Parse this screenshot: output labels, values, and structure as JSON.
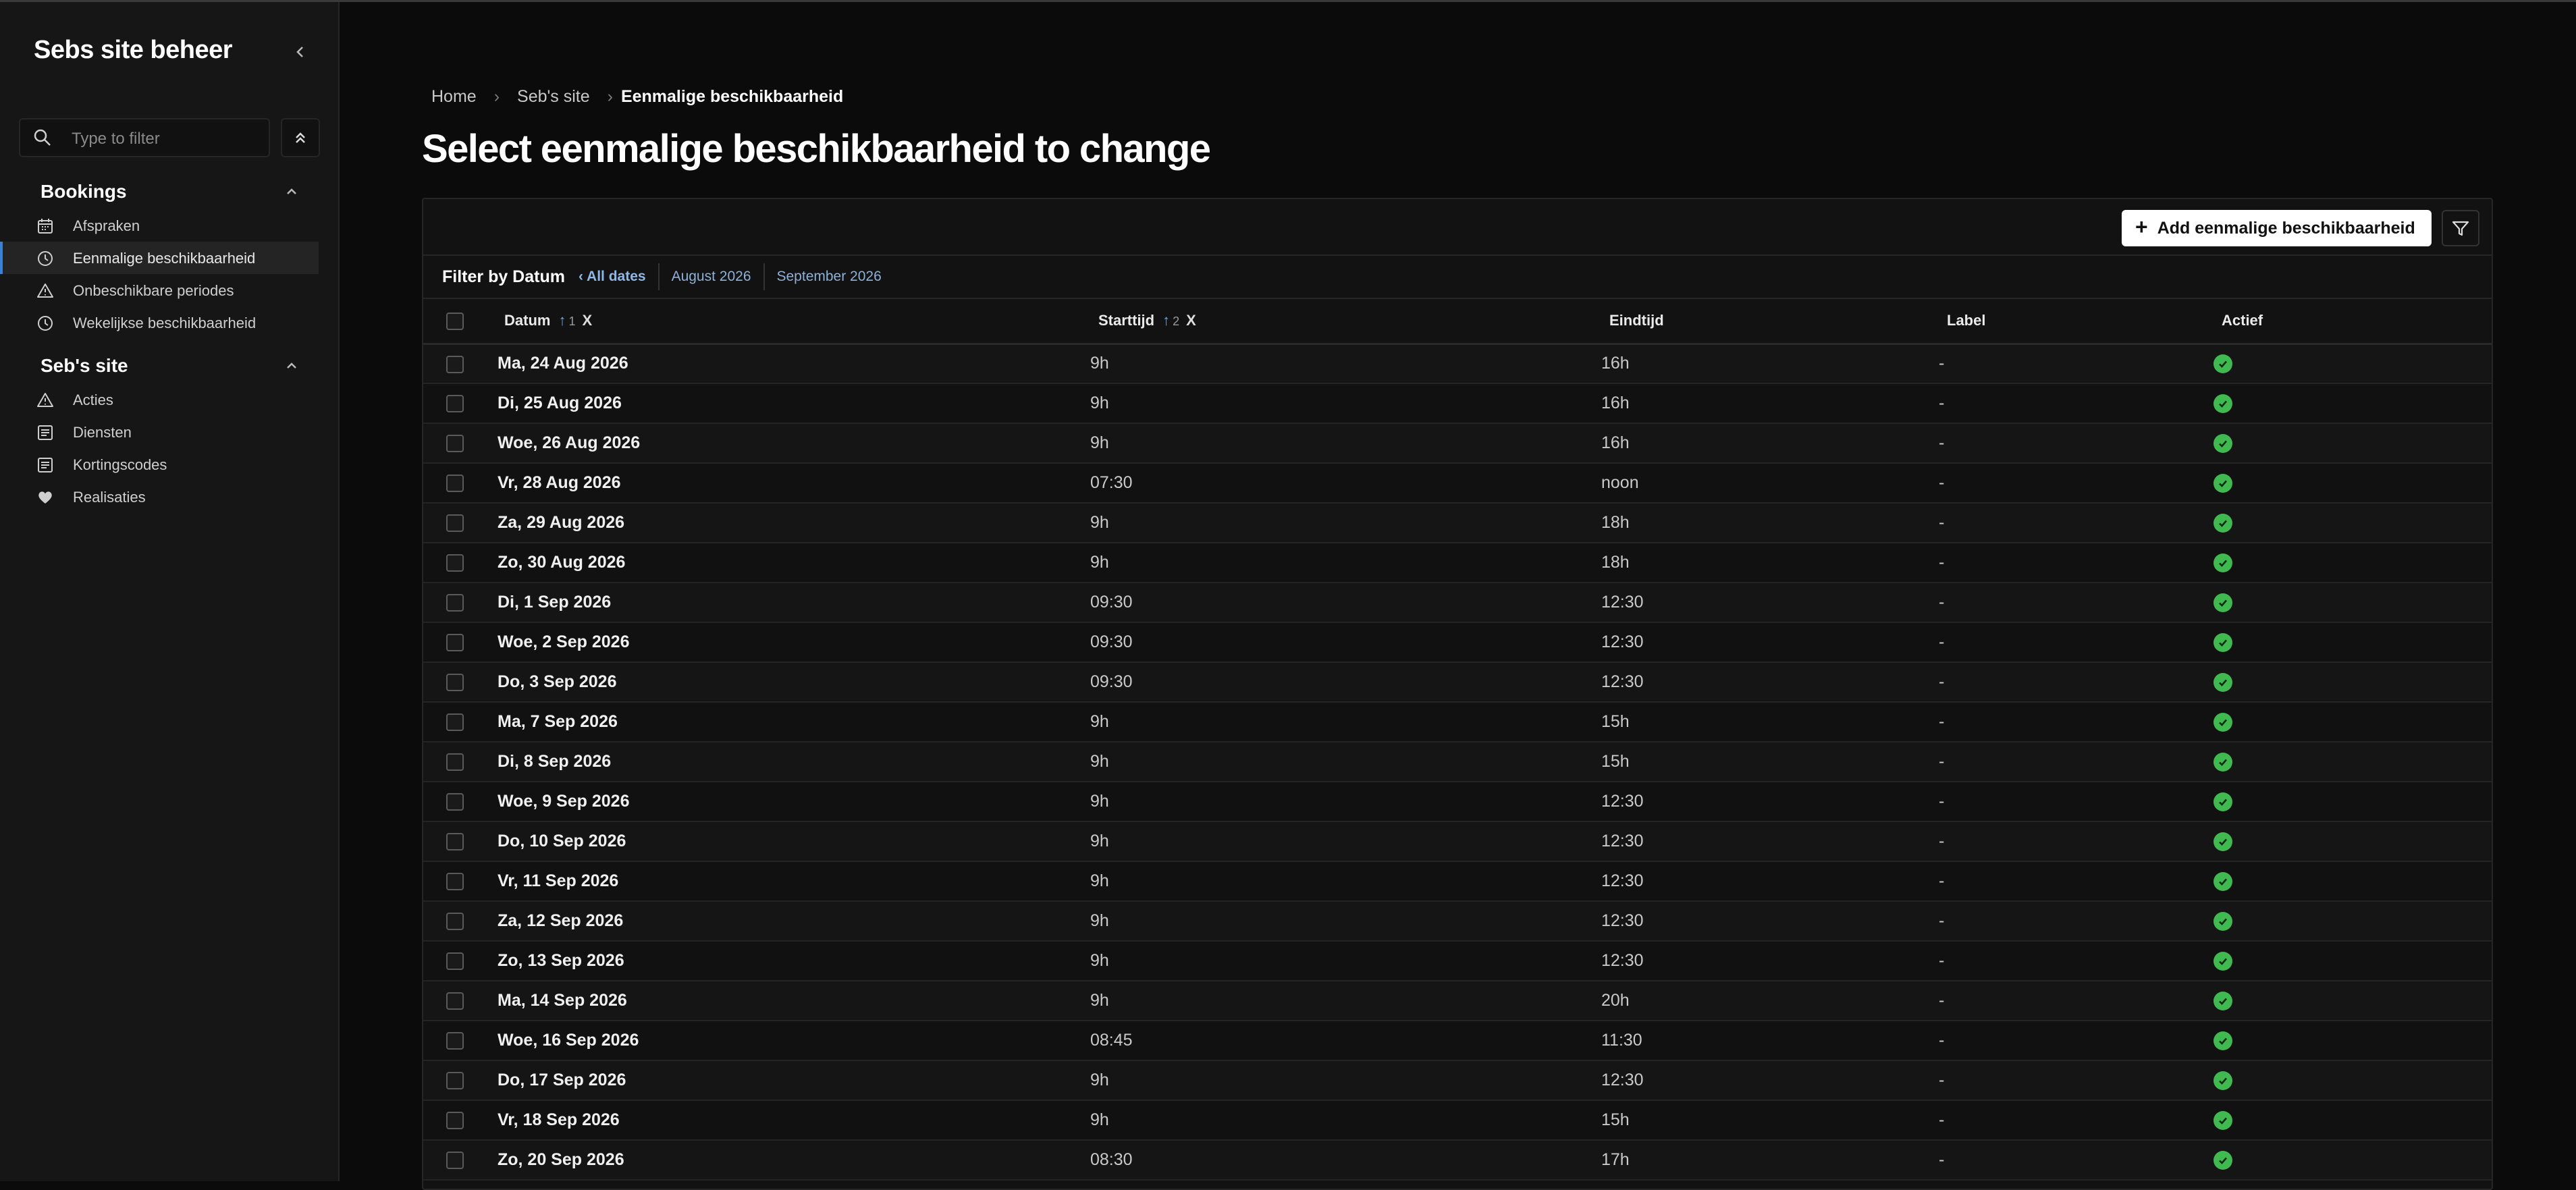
{
  "sidebar": {
    "brand": "Sebs site beheer",
    "search_placeholder": "Type to filter",
    "sections": [
      {
        "title": "Bookings",
        "items": [
          {
            "label": "Afspraken",
            "icon": "calendar-icon"
          },
          {
            "label": "Eenmalige beschikbaarheid",
            "icon": "clock-icon",
            "active": true
          },
          {
            "label": "Onbeschikbare periodes",
            "icon": "warning-icon"
          },
          {
            "label": "Wekelijkse beschikbaarheid",
            "icon": "clock-icon"
          }
        ]
      },
      {
        "title": "Seb's site",
        "items": [
          {
            "label": "Acties",
            "icon": "warning-icon"
          },
          {
            "label": "Diensten",
            "icon": "list-icon"
          },
          {
            "label": "Kortingscodes",
            "icon": "list-icon"
          },
          {
            "label": "Realisaties",
            "icon": "heart-icon"
          }
        ]
      }
    ]
  },
  "breadcrumb": [
    "Home",
    "Seb's site",
    "Eenmalige beschikbaarheid"
  ],
  "page_title": "Select eenmalige beschikbaarheid to change",
  "toolbar": {
    "add_label": "Add eenmalige beschikbaarheid"
  },
  "filter": {
    "label": "Filter by Datum",
    "all_label": "‹ All dates",
    "options": [
      "August 2026",
      "September 2026"
    ]
  },
  "table": {
    "columns": {
      "datum": "Datum",
      "datum_sort": "1",
      "starttijd": "Starttijd",
      "starttijd_sort": "2",
      "eindtijd": "Eindtijd",
      "label": "Label",
      "actief": "Actief"
    },
    "rows": [
      {
        "datum": "Ma, 24 Aug 2026",
        "start": "9h",
        "eind": "16h",
        "label": "-",
        "actief": true
      },
      {
        "datum": "Di, 25 Aug 2026",
        "start": "9h",
        "eind": "16h",
        "label": "-",
        "actief": true
      },
      {
        "datum": "Woe, 26 Aug 2026",
        "start": "9h",
        "eind": "16h",
        "label": "-",
        "actief": true
      },
      {
        "datum": "Vr, 28 Aug 2026",
        "start": "07:30",
        "eind": "noon",
        "label": "-",
        "actief": true
      },
      {
        "datum": "Za, 29 Aug 2026",
        "start": "9h",
        "eind": "18h",
        "label": "-",
        "actief": true
      },
      {
        "datum": "Zo, 30 Aug 2026",
        "start": "9h",
        "eind": "18h",
        "label": "-",
        "actief": true
      },
      {
        "datum": "Di, 1 Sep 2026",
        "start": "09:30",
        "eind": "12:30",
        "label": "-",
        "actief": true
      },
      {
        "datum": "Woe, 2 Sep 2026",
        "start": "09:30",
        "eind": "12:30",
        "label": "-",
        "actief": true
      },
      {
        "datum": "Do, 3 Sep 2026",
        "start": "09:30",
        "eind": "12:30",
        "label": "-",
        "actief": true
      },
      {
        "datum": "Ma, 7 Sep 2026",
        "start": "9h",
        "eind": "15h",
        "label": "-",
        "actief": true
      },
      {
        "datum": "Di, 8 Sep 2026",
        "start": "9h",
        "eind": "15h",
        "label": "-",
        "actief": true
      },
      {
        "datum": "Woe, 9 Sep 2026",
        "start": "9h",
        "eind": "12:30",
        "label": "-",
        "actief": true
      },
      {
        "datum": "Do, 10 Sep 2026",
        "start": "9h",
        "eind": "12:30",
        "label": "-",
        "actief": true
      },
      {
        "datum": "Vr, 11 Sep 2026",
        "start": "9h",
        "eind": "12:30",
        "label": "-",
        "actief": true
      },
      {
        "datum": "Za, 12 Sep 2026",
        "start": "9h",
        "eind": "12:30",
        "label": "-",
        "actief": true
      },
      {
        "datum": "Zo, 13 Sep 2026",
        "start": "9h",
        "eind": "12:30",
        "label": "-",
        "actief": true
      },
      {
        "datum": "Ma, 14 Sep 2026",
        "start": "9h",
        "eind": "20h",
        "label": "-",
        "actief": true
      },
      {
        "datum": "Woe, 16 Sep 2026",
        "start": "08:45",
        "eind": "11:30",
        "label": "-",
        "actief": true
      },
      {
        "datum": "Do, 17 Sep 2026",
        "start": "9h",
        "eind": "12:30",
        "label": "-",
        "actief": true
      },
      {
        "datum": "Vr, 18 Sep 2026",
        "start": "9h",
        "eind": "15h",
        "label": "-",
        "actief": true
      },
      {
        "datum": "Zo, 20 Sep 2026",
        "start": "08:30",
        "eind": "17h",
        "label": "-",
        "actief": true
      }
    ]
  },
  "colors": {
    "background": "#0b0b0b",
    "sidebar": "#161616",
    "accent": "#3b82d6",
    "success": "#3fb950",
    "filter_link": "#8fb0d8"
  }
}
